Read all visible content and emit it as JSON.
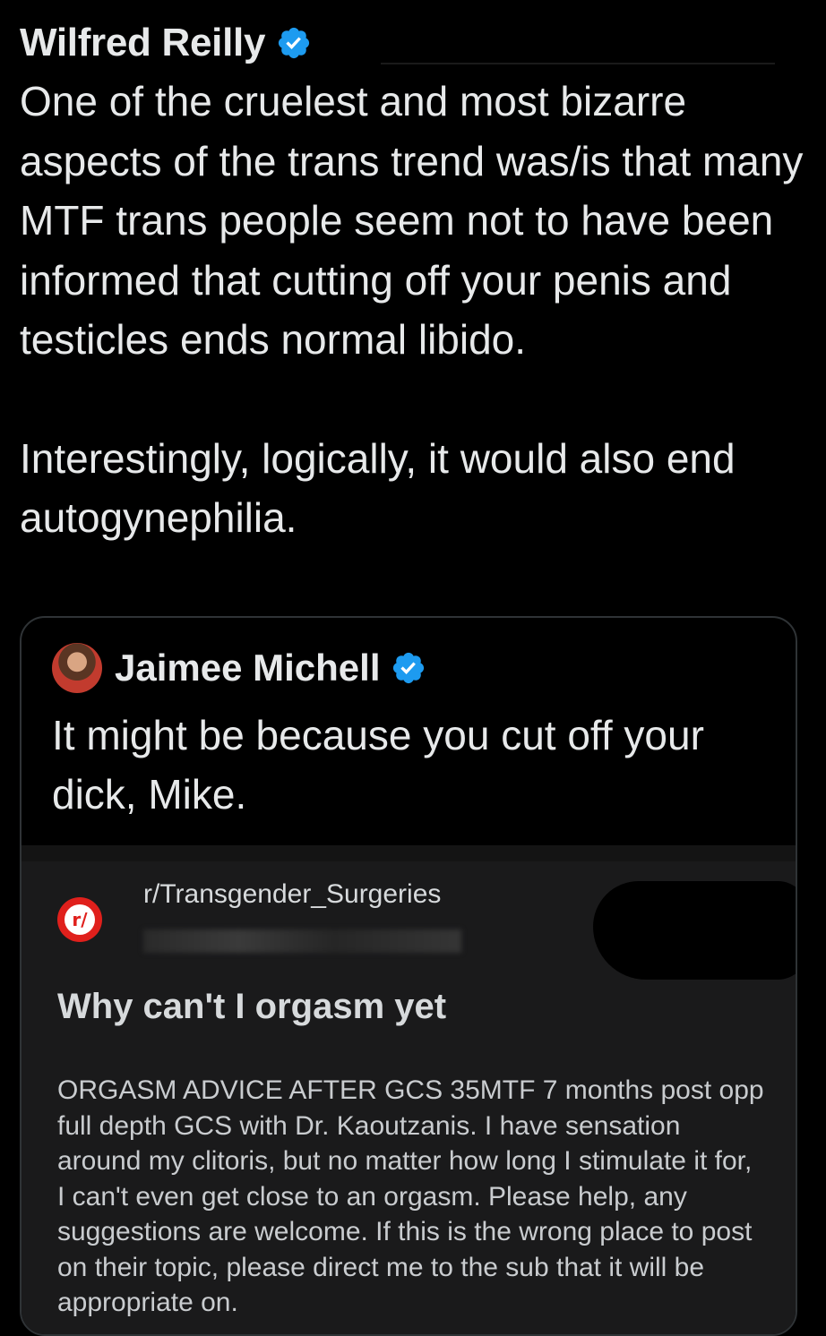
{
  "tweet": {
    "author_name": "Wilfred Reilly",
    "verified_icon": "verified-badge-icon",
    "paragraphs": [
      "One of the cruelest and most bizarre aspects of the trans trend was/is that many MTF trans people seem not to have been informed that cutting off your penis and testicles ends normal libido.",
      "Interestingly, logically, it would also end autogynephilia."
    ]
  },
  "quote": {
    "author_name": "Jaimee Michell",
    "text": "It might be because you cut off your dick, Mike.",
    "embed": {
      "subreddit": "r/Transgender_Surgeries",
      "subreddit_icon_text": "r/",
      "post_title": "Why can't I orgasm yet",
      "post_body": "ORGASM ADVICE AFTER GCS 35MTF 7 months post opp full depth GCS with Dr. Kaoutzanis. I have sensation around my clitoris, but no matter how long I stimulate it for, I can't even get close to an orgasm. Please help, any suggestions are welcome. If this is the wrong place to post on their topic, please direct me to the sub that it will be appropriate on."
    }
  },
  "colors": {
    "background": "#000000",
    "text": "#e7e9ea",
    "verified_blue": "#1d9bf0",
    "card_border": "#2f3336",
    "reddit_red": "#e0201c",
    "embed_bg": "#1a1a1b"
  }
}
